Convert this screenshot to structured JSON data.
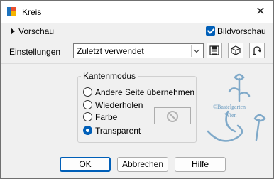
{
  "window": {
    "title": "Kreis",
    "close_glyph": "✕"
  },
  "preview": {
    "toggle_label": "Vorschau",
    "checkbox_label": "Bildvorschau",
    "checked": true
  },
  "settings": {
    "label": "Einstellungen",
    "combo_value": "Zuletzt verwendet",
    "icons": [
      "save-icon",
      "cube-icon",
      "reset-icon"
    ]
  },
  "edge_mode": {
    "title": "Kantenmodus",
    "options": [
      "Andere Seite übernehmen",
      "Wiederholen",
      "Farbe",
      "Transparent"
    ],
    "selected": "Transparent"
  },
  "watermark": {
    "line1": "©Bastelgarten",
    "line2": "Wien"
  },
  "buttons": {
    "ok": "OK",
    "cancel": "Abbrechen",
    "help": "Hilfe"
  },
  "colors": {
    "accent": "#005fb8",
    "background": "#f0f0f0",
    "watermark": "#7fa9c9"
  }
}
